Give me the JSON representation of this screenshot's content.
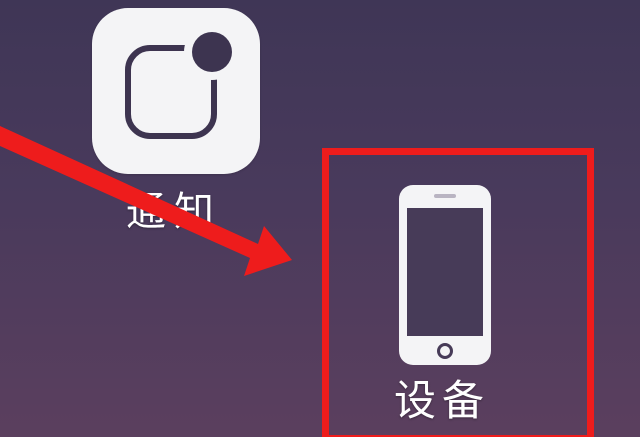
{
  "apps": {
    "notifications": {
      "label": "通知",
      "icon": "notification-badge-icon"
    },
    "device": {
      "label": "设备",
      "icon": "smartphone-icon"
    }
  },
  "annotation": {
    "highlight_color": "#ee1c1c",
    "arrow_color": "#ee1c1c",
    "highlighted_app": "device"
  },
  "colors": {
    "background_top": "#3f3656",
    "background_bottom": "#5b3f5e",
    "icon_tile": "#f4f4f6",
    "icon_glyph": "#3d3450"
  }
}
